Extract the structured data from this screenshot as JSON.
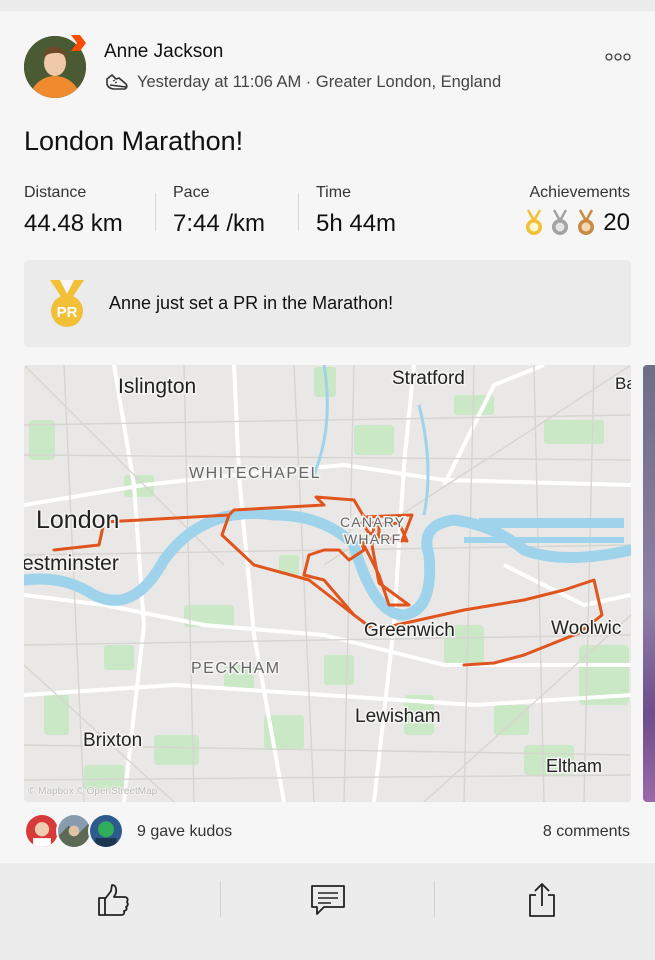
{
  "athlete": {
    "name": "Anne Jackson"
  },
  "activity": {
    "meta": "Yesterday at 11:06 AM · Greater London, England",
    "title": "London Marathon!",
    "sport_icon": "running-shoe-icon"
  },
  "stats": {
    "distance": {
      "label": "Distance",
      "value": "44.48 km"
    },
    "pace": {
      "label": "Pace",
      "value": "7:44 /km"
    },
    "time": {
      "label": "Time",
      "value": "5h 44m"
    },
    "achievements": {
      "label": "Achievements",
      "count": "20",
      "medals": [
        "gold",
        "silver",
        "bronze"
      ]
    }
  },
  "pr_banner": {
    "badge": "PR",
    "text": "Anne just set a PR in the Marathon!"
  },
  "map": {
    "labels": {
      "islington": "Islington",
      "stratford": "Stratford",
      "barking": "Ba",
      "whitechapel": "WHITECHAPEL",
      "london": "London",
      "canary": "CANARY",
      "wharf": "WHARF",
      "westminster": "estminster",
      "greenwich": "Greenwich",
      "woolwich": "Woolwic",
      "peckham": "PECKHAM",
      "lewisham": "Lewisham",
      "brixton": "Brixton",
      "eltham": "Eltham"
    },
    "attribution": "© Mapbox  © OpenStreetMap",
    "route_color": "#e0541d",
    "water_color": "#9fd3ec",
    "park_color": "#cbe8c6"
  },
  "social": {
    "kudos": "9 gave kudos",
    "comments": "8 comments"
  },
  "actions": [
    "thumbs-up-icon",
    "comment-icon",
    "share-icon"
  ],
  "colors": {
    "accent": "#fc4c02",
    "gold": "#f2c037",
    "silver": "#a3a3a3",
    "bronze": "#c98b43"
  }
}
